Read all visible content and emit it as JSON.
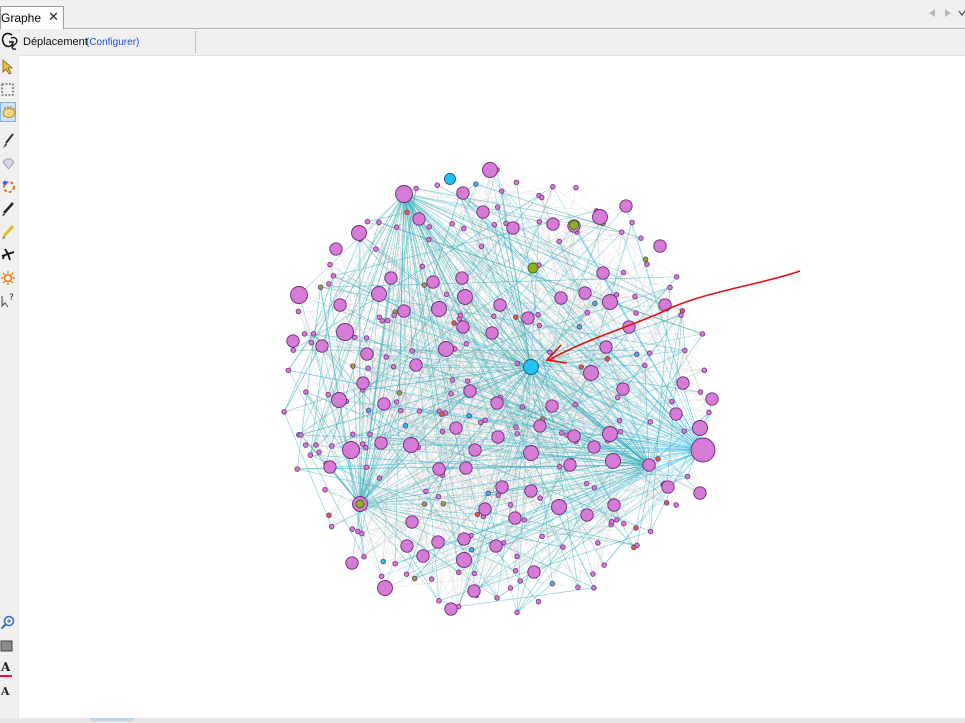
{
  "tab": {
    "label": "Graphe",
    "close_glyph": "✕"
  },
  "tab_nav": {
    "prev_icon": "triangle-left-icon",
    "next_icon": "triangle-right-icon",
    "menu_icon": "chevron-down-icon"
  },
  "toolbar": {
    "logo_icon": "gephi-logo-icon",
    "mode_label": "Déplacement",
    "configure_link": "(Configurer)"
  },
  "tools": [
    {
      "name": "pointer-tool",
      "icon": "arrow-pointer-icon",
      "active": false
    },
    {
      "name": "rect-select-tool",
      "icon": "dashed-rectangle-icon",
      "active": false
    },
    {
      "name": "hand-tool",
      "icon": "hand-icon",
      "active": true
    },
    {
      "name": "brush-tool",
      "icon": "brush-icon",
      "active": false
    },
    {
      "name": "diamond-tool",
      "icon": "diamond-icon",
      "active": false
    },
    {
      "name": "painter-tool",
      "icon": "color-wheel-icon",
      "active": false
    },
    {
      "name": "pencil-tool",
      "icon": "pencil-icon",
      "active": false
    },
    {
      "name": "edge-pencil-tool",
      "icon": "yellow-pencil-icon",
      "active": false
    },
    {
      "name": "shortest-path-tool",
      "icon": "plane-icon",
      "active": false
    },
    {
      "name": "heat-map-tool",
      "icon": "sun-icon",
      "active": false
    },
    {
      "name": "edit-tool",
      "icon": "question-cursor-icon",
      "active": false
    }
  ],
  "bottom_tools": [
    {
      "name": "zoom-tool",
      "icon": "magnifier-icon"
    },
    {
      "name": "background-color-tool",
      "icon": "gray-square-icon"
    },
    {
      "name": "label-color-tool",
      "icon": "label-a-red-icon"
    },
    {
      "name": "label-size-tool",
      "icon": "label-a-small-icon"
    }
  ],
  "bottom_labels": {
    "label_color": "A",
    "label_size": "A"
  },
  "colors": {
    "node_main": "#d67bd6",
    "node_cyan": "#22c3f0",
    "node_olive": "#8db020",
    "edge_gray": "#c8c8c8",
    "edge_teal": "#3aaeb8",
    "annotation_red": "#e01010"
  }
}
